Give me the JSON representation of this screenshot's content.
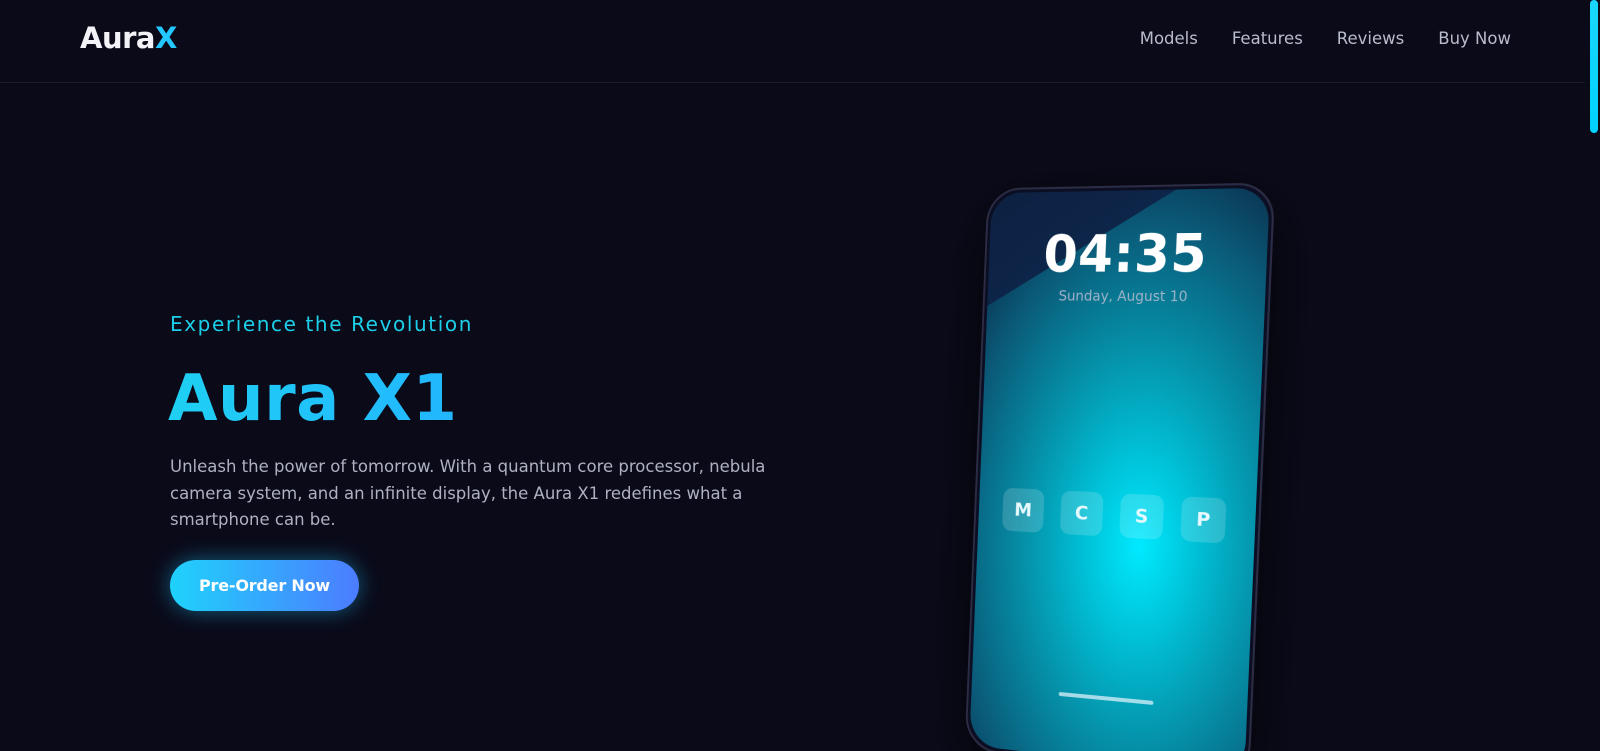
{
  "brand": {
    "logo_main": "Aura",
    "logo_accent": "X"
  },
  "nav": {
    "items": [
      {
        "label": "Models"
      },
      {
        "label": "Features"
      },
      {
        "label": "Reviews"
      },
      {
        "label": "Buy Now"
      }
    ]
  },
  "hero": {
    "eyebrow": "Experience the Revolution",
    "title": "Aura X1",
    "description": "Unleash the power of tomorrow. With a quantum core processor, nebula camera system, and an infinite display, the Aura X1 redefines what a smartphone can be.",
    "cta_label": "Pre-Order Now"
  },
  "phone": {
    "time": "04:35",
    "date": "Sunday, August 10",
    "apps": [
      {
        "letter": "M"
      },
      {
        "letter": "C"
      },
      {
        "letter": "S"
      },
      {
        "letter": "P"
      }
    ]
  },
  "colors": {
    "background": "#0a0a19",
    "accent_cyan": "#1fd0f2",
    "accent_blue": "#4c7cff",
    "text_muted": "#aeb1c2"
  }
}
